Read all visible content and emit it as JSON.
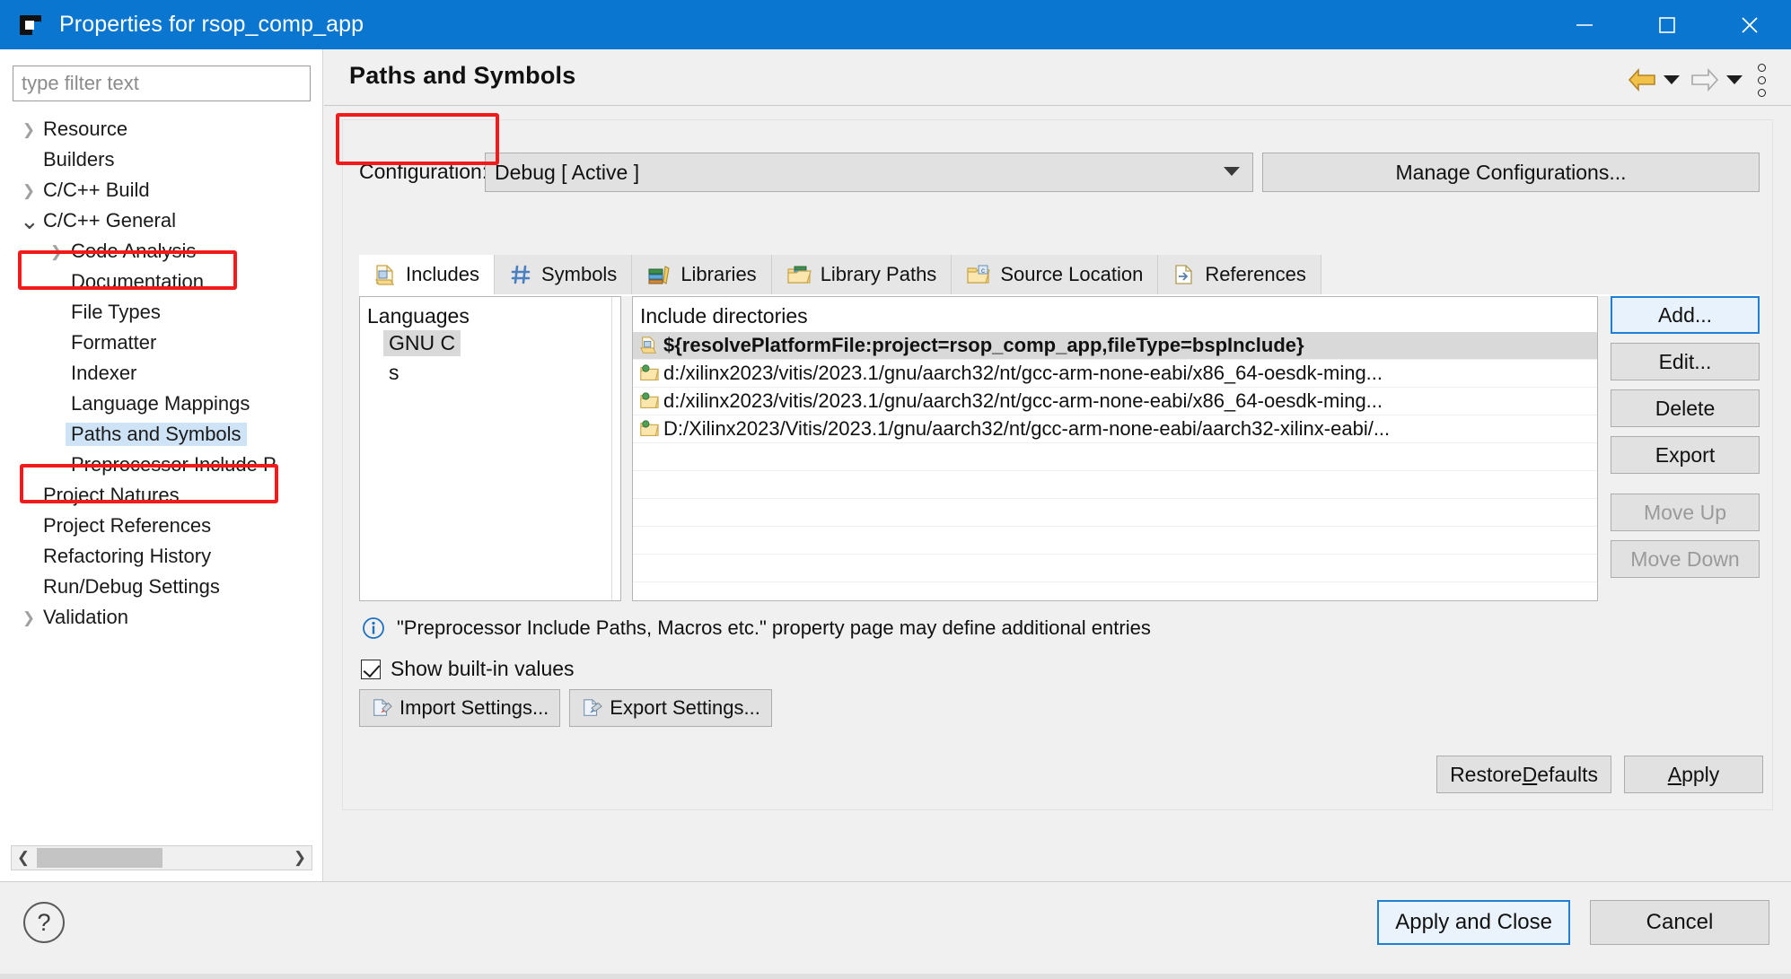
{
  "window": {
    "title": "Properties for rsop_comp_app",
    "icon": "eclipse-app-icon",
    "minimize_label": "—",
    "maximize_label": "☐",
    "close_label": "✕",
    "titlebar_color": "#0a76d0"
  },
  "sidebar": {
    "filter_placeholder": "type filter text",
    "filter_value": "",
    "items": [
      {
        "label": "Resource",
        "indent": 0,
        "arrow": "right",
        "selected": false,
        "highlight": false
      },
      {
        "label": "Builders",
        "indent": 0,
        "arrow": "none",
        "selected": false,
        "highlight": false
      },
      {
        "label": "C/C++ Build",
        "indent": 0,
        "arrow": "right",
        "selected": false,
        "highlight": false
      },
      {
        "label": "C/C++ General",
        "indent": 0,
        "arrow": "down",
        "selected": false,
        "highlight": true
      },
      {
        "label": "Code Analysis",
        "indent": 1,
        "arrow": "right",
        "selected": false,
        "highlight": false
      },
      {
        "label": "Documentation",
        "indent": 1,
        "arrow": "none",
        "selected": false,
        "highlight": false
      },
      {
        "label": "File Types",
        "indent": 1,
        "arrow": "none",
        "selected": false,
        "highlight": false
      },
      {
        "label": "Formatter",
        "indent": 1,
        "arrow": "none",
        "selected": false,
        "highlight": false
      },
      {
        "label": "Indexer",
        "indent": 1,
        "arrow": "none",
        "selected": false,
        "highlight": false
      },
      {
        "label": "Language Mappings",
        "indent": 1,
        "arrow": "none",
        "selected": false,
        "highlight": false
      },
      {
        "label": "Paths and Symbols",
        "indent": 1,
        "arrow": "none",
        "selected": true,
        "highlight": true
      },
      {
        "label": "Preprocessor Include P",
        "indent": 1,
        "arrow": "none",
        "selected": false,
        "highlight": false
      },
      {
        "label": "Project Natures",
        "indent": 0,
        "arrow": "none",
        "selected": false,
        "highlight": false
      },
      {
        "label": "Project References",
        "indent": 0,
        "arrow": "none",
        "selected": false,
        "highlight": false
      },
      {
        "label": "Refactoring History",
        "indent": 0,
        "arrow": "none",
        "selected": false,
        "highlight": false
      },
      {
        "label": "Run/Debug Settings",
        "indent": 0,
        "arrow": "none",
        "selected": false,
        "highlight": false
      },
      {
        "label": "Validation",
        "indent": 0,
        "arrow": "right",
        "selected": false,
        "highlight": false
      }
    ],
    "highlight_color": "#f11b1b",
    "selection_color": "#cfe3f7"
  },
  "page": {
    "title": "Paths and Symbols",
    "nav": {
      "back_icon": "back-arrow-icon",
      "back_caret_icon": "chevron-down-icon",
      "forward_icon": "forward-arrow-icon",
      "forward_caret_icon": "chevron-down-icon",
      "menu_icon": "vertical-ellipsis-icon"
    }
  },
  "configuration": {
    "label": "Configuration:",
    "value": "Debug  [ Active ]",
    "manage_label": "Manage Configurations..."
  },
  "tabs": [
    {
      "label": "Includes",
      "icon": "includes-icon",
      "active": true
    },
    {
      "label": "Symbols",
      "icon": "hash-icon",
      "active": false
    },
    {
      "label": "Libraries",
      "icon": "books-icon",
      "active": false
    },
    {
      "label": "Library Paths",
      "icon": "folder-books-icon",
      "active": false
    },
    {
      "label": "Source Location",
      "icon": "folder-source-icon",
      "active": false
    },
    {
      "label": "References",
      "icon": "references-icon",
      "active": false
    }
  ],
  "languages": {
    "header": "Languages",
    "items": [
      {
        "label": "GNU C",
        "selected": true
      },
      {
        "label": "s",
        "selected": false
      }
    ]
  },
  "includes": {
    "header": "Include directories",
    "rows": [
      {
        "text": "${resolvePlatformFile:project=rsop_comp_app,fileType=bspInclude}",
        "icon": "include-file-icon",
        "selected": true
      },
      {
        "text": "d:/xilinx2023/vitis/2023.1/gnu/aarch32/nt/gcc-arm-none-eabi/x86_64-oesdk-ming...",
        "icon": "builtin-folder-icon",
        "selected": false
      },
      {
        "text": "d:/xilinx2023/vitis/2023.1/gnu/aarch32/nt/gcc-arm-none-eabi/x86_64-oesdk-ming...",
        "icon": "builtin-folder-icon",
        "selected": false
      },
      {
        "text": "D:/Xilinx2023/Vitis/2023.1/gnu/aarch32/nt/gcc-arm-none-eabi/aarch32-xilinx-eabi/...",
        "icon": "builtin-folder-icon",
        "selected": false
      }
    ]
  },
  "side_buttons": [
    {
      "label": "Add...",
      "state": "focused"
    },
    {
      "label": "Edit...",
      "state": "normal"
    },
    {
      "label": "Delete",
      "state": "normal"
    },
    {
      "label": "Export",
      "state": "normal"
    },
    {
      "label": "Move Up",
      "state": "disabled"
    },
    {
      "label": "Move Down",
      "state": "disabled"
    }
  ],
  "info": {
    "icon": "info-icon",
    "text": "\"Preprocessor Include Paths, Macros etc.\" property page may define additional entries"
  },
  "show_builtin": {
    "label": "Show built-in values",
    "checked": true
  },
  "settings_buttons": [
    {
      "label": "Import Settings...",
      "icon": "import-icon"
    },
    {
      "label": "Export Settings...",
      "icon": "export-icon"
    }
  ],
  "page_buttons": {
    "restore_pre": "Restore ",
    "restore_accel": "D",
    "restore_post": "efaults",
    "apply_accel": "A",
    "apply_post": "pply"
  },
  "footer": {
    "help_label": "?",
    "apply_close_label": "Apply and Close",
    "cancel_label": "Cancel"
  }
}
